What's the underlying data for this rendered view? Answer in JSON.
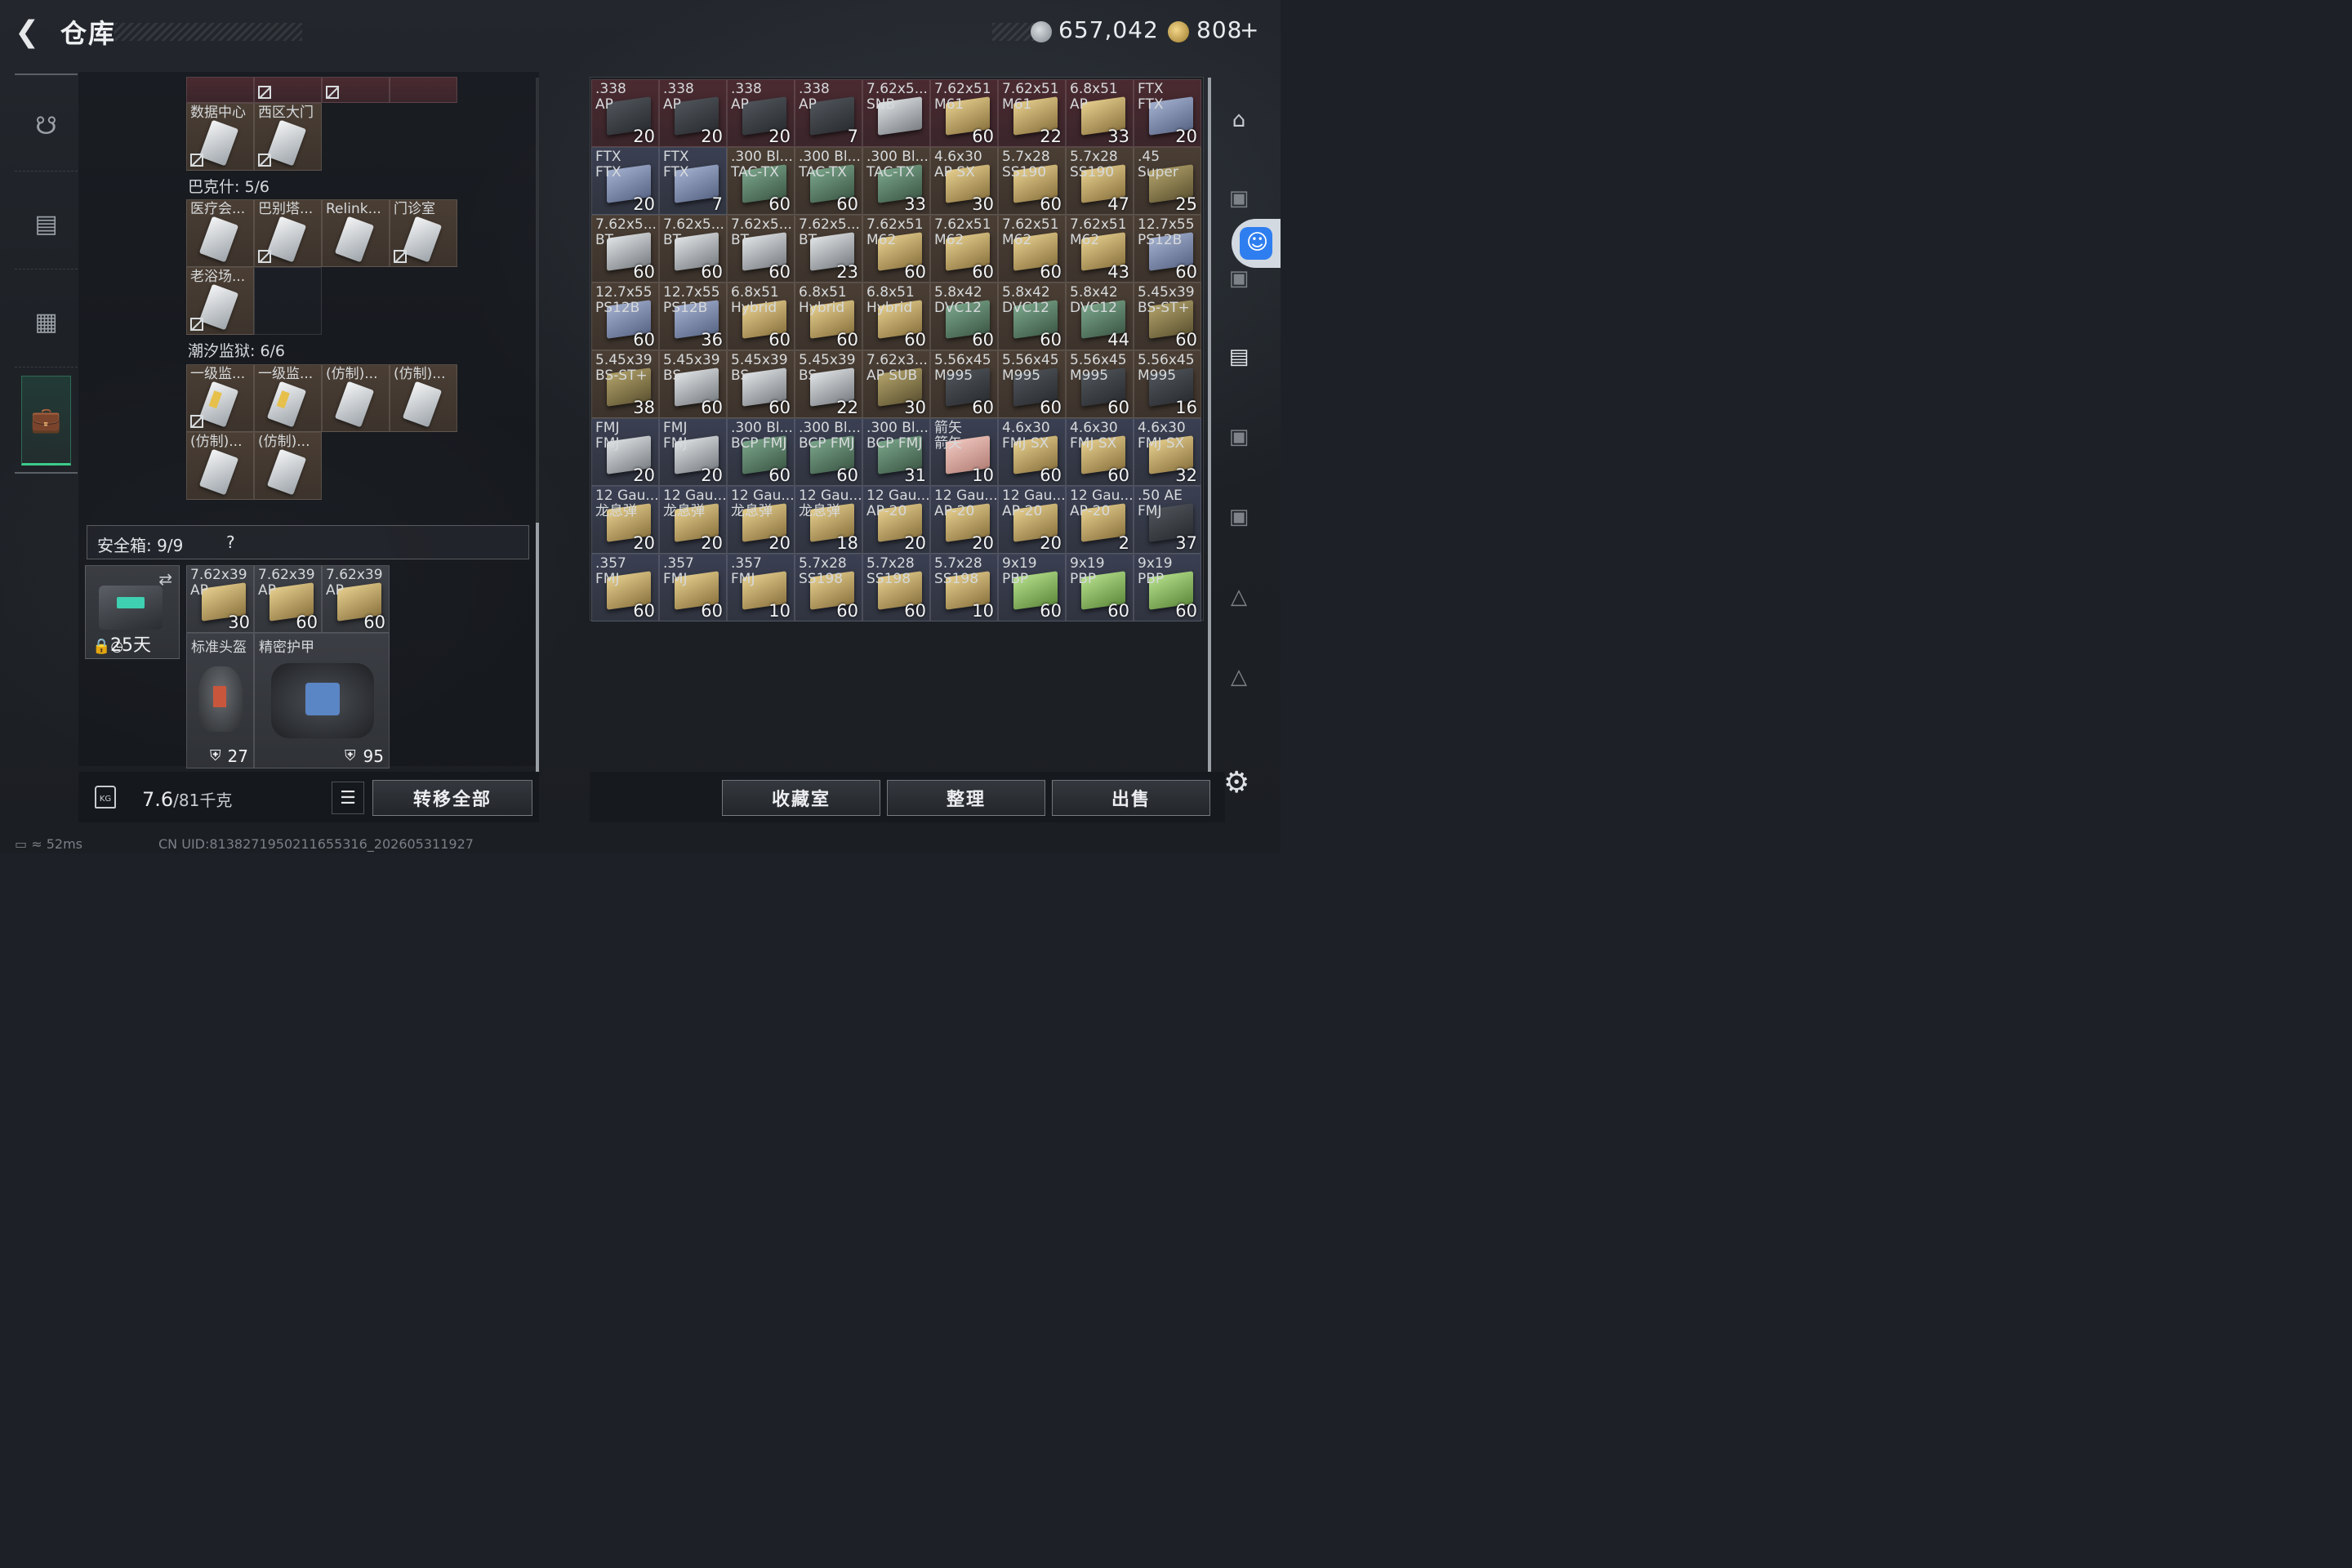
{
  "header": {
    "title": "仓库",
    "silver": "657,042",
    "gold": "808",
    "gold_plus": "+"
  },
  "left": {
    "section_bakeshi": "巴克什: 5/6",
    "section_chaoxi": "潮汐监狱: 6/6",
    "keys_top": [
      {
        "name": "数据中心",
        "locked": true
      },
      {
        "name": "西区大门",
        "locked": true
      }
    ],
    "keys_bakeshi": [
      {
        "name": "医疗会...",
        "locked": false
      },
      {
        "name": "巴别塔...",
        "locked": true
      },
      {
        "name": "Relink...",
        "locked": false
      },
      {
        "name": "门诊室",
        "locked": true
      },
      {
        "name": "老浴场...",
        "locked": true
      }
    ],
    "keys_chaoxi": [
      {
        "name": "一级监...",
        "locked": true
      },
      {
        "name": "一级监...",
        "locked": false
      },
      {
        "name": "(仿制)...",
        "locked": false
      },
      {
        "name": "(仿制)...",
        "locked": false
      },
      {
        "name": "(仿制)...",
        "locked": false
      },
      {
        "name": "(仿制)...",
        "locked": false
      }
    ],
    "safebox": {
      "label": "安全箱:",
      "count": "9/9",
      "help": "?",
      "days": "25天"
    },
    "safebox_items": [
      {
        "n1": "7.62x39",
        "n2": "AP",
        "count": "30"
      },
      {
        "n1": "7.62x39",
        "n2": "AP",
        "count": "60"
      },
      {
        "n1": "7.62x39",
        "n2": "AP",
        "count": "60"
      }
    ],
    "helmet": {
      "name": "标准头盔",
      "dur": "27"
    },
    "armor": {
      "name": "精密护甲",
      "dur": "95"
    },
    "weight": "7.6",
    "weight_max": "/81千克",
    "transfer_all": "转移全部"
  },
  "bottom": {
    "collection": "收藏室",
    "sort": "整理",
    "sell": "出售"
  },
  "status": {
    "ping": "52ms",
    "uid": "CN UID:8138271950211655316_202605311927"
  },
  "grid": [
    {
      "n1": ".338",
      "n2": "AP",
      "count": "20",
      "bg": "red",
      "box": "t-dark"
    },
    {
      "n1": ".338",
      "n2": "AP",
      "count": "20",
      "bg": "red",
      "box": "t-dark"
    },
    {
      "n1": ".338",
      "n2": "AP",
      "count": "20",
      "bg": "red",
      "box": "t-dark"
    },
    {
      "n1": ".338",
      "n2": "AP",
      "count": "7",
      "bg": "red",
      "box": "t-dark"
    },
    {
      "n1": "7.62x5...",
      "n2": "SNB",
      "count": "",
      "bg": "red",
      "box": "t-gray"
    },
    {
      "n1": "7.62x51",
      "n2": "M61",
      "count": "60",
      "bg": "red",
      "box": "t-tan"
    },
    {
      "n1": "7.62x51",
      "n2": "M61",
      "count": "22",
      "bg": "red",
      "box": "t-tan"
    },
    {
      "n1": "6.8x51",
      "n2": "AP",
      "count": "33",
      "bg": "red",
      "box": "t-tan"
    },
    {
      "n1": "FTX",
      "n2": "FTX",
      "count": "20",
      "bg": "red",
      "box": "t-blue"
    },
    {
      "n1": "FTX",
      "n2": "FTX",
      "count": "20",
      "bg": "blue",
      "box": "t-blue"
    },
    {
      "n1": "FTX",
      "n2": "FTX",
      "count": "7",
      "bg": "blue",
      "box": "t-blue"
    },
    {
      "n1": ".300 Bl...",
      "n2": "TAC-TX",
      "count": "60",
      "bg": "brown",
      "box": "t-green"
    },
    {
      "n1": ".300 Bl...",
      "n2": "TAC-TX",
      "count": "60",
      "bg": "brown",
      "box": "t-green"
    },
    {
      "n1": ".300 Bl...",
      "n2": "TAC-TX",
      "count": "33",
      "bg": "brown",
      "box": "t-green"
    },
    {
      "n1": "4.6x30",
      "n2": "AP SX",
      "count": "30",
      "bg": "brown",
      "box": "t-tan"
    },
    {
      "n1": "5.7x28",
      "n2": "SS190",
      "count": "60",
      "bg": "brown",
      "box": "t-tan"
    },
    {
      "n1": "5.7x28",
      "n2": "SS190",
      "count": "47",
      "bg": "brown",
      "box": "t-tan"
    },
    {
      "n1": ".45",
      "n2": "Super",
      "count": "25",
      "bg": "brown",
      "box": "t-olive"
    },
    {
      "n1": "7.62x5...",
      "n2": "BT",
      "count": "60",
      "bg": "brown",
      "box": "t-gray"
    },
    {
      "n1": "7.62x5...",
      "n2": "BT",
      "count": "60",
      "bg": "brown",
      "box": "t-gray"
    },
    {
      "n1": "7.62x5...",
      "n2": "BT",
      "count": "60",
      "bg": "brown",
      "box": "t-gray"
    },
    {
      "n1": "7.62x5...",
      "n2": "BT",
      "count": "23",
      "bg": "brown",
      "box": "t-gray"
    },
    {
      "n1": "7.62x51",
      "n2": "M62",
      "count": "60",
      "bg": "brown",
      "box": "t-tan"
    },
    {
      "n1": "7.62x51",
      "n2": "M62",
      "count": "60",
      "bg": "brown",
      "box": "t-tan"
    },
    {
      "n1": "7.62x51",
      "n2": "M62",
      "count": "60",
      "bg": "brown",
      "box": "t-tan"
    },
    {
      "n1": "7.62x51",
      "n2": "M62",
      "count": "43",
      "bg": "brown",
      "box": "t-tan"
    },
    {
      "n1": "12.7x55",
      "n2": "PS12B",
      "count": "60",
      "bg": "brown",
      "box": "t-blue"
    },
    {
      "n1": "12.7x55",
      "n2": "PS12B",
      "count": "60",
      "bg": "brown",
      "box": "t-blue"
    },
    {
      "n1": "12.7x55",
      "n2": "PS12B",
      "count": "36",
      "bg": "brown",
      "box": "t-blue"
    },
    {
      "n1": "6.8x51",
      "n2": "Hybrid",
      "count": "60",
      "bg": "brown",
      "box": "t-tan"
    },
    {
      "n1": "6.8x51",
      "n2": "Hybrid",
      "count": "60",
      "bg": "brown",
      "box": "t-tan"
    },
    {
      "n1": "6.8x51",
      "n2": "Hybrid",
      "count": "60",
      "bg": "brown",
      "box": "t-tan"
    },
    {
      "n1": "5.8x42",
      "n2": "DVC12",
      "count": "60",
      "bg": "brown",
      "box": "t-green"
    },
    {
      "n1": "5.8x42",
      "n2": "DVC12",
      "count": "60",
      "bg": "brown",
      "box": "t-green"
    },
    {
      "n1": "5.8x42",
      "n2": "DVC12",
      "count": "44",
      "bg": "brown",
      "box": "t-green"
    },
    {
      "n1": "5.45x39",
      "n2": "BS-ST+",
      "count": "60",
      "bg": "brown",
      "box": "t-olive"
    },
    {
      "n1": "5.45x39",
      "n2": "BS-ST+",
      "count": "38",
      "bg": "brown",
      "box": "t-olive"
    },
    {
      "n1": "5.45x39",
      "n2": "BS",
      "count": "60",
      "bg": "brown",
      "box": "t-gray"
    },
    {
      "n1": "5.45x39",
      "n2": "BS",
      "count": "60",
      "bg": "brown",
      "box": "t-gray"
    },
    {
      "n1": "5.45x39",
      "n2": "BS",
      "count": "22",
      "bg": "brown",
      "box": "t-gray"
    },
    {
      "n1": "7.62x3...",
      "n2": "AP SUB",
      "count": "30",
      "bg": "brown",
      "box": "t-olive"
    },
    {
      "n1": "5.56x45",
      "n2": "M995",
      "count": "60",
      "bg": "brown",
      "box": "t-dark"
    },
    {
      "n1": "5.56x45",
      "n2": "M995",
      "count": "60",
      "bg": "brown",
      "box": "t-dark"
    },
    {
      "n1": "5.56x45",
      "n2": "M995",
      "count": "60",
      "bg": "brown",
      "box": "t-dark"
    },
    {
      "n1": "5.56x45",
      "n2": "M995",
      "count": "16",
      "bg": "brown",
      "box": "t-dark"
    },
    {
      "n1": "FMJ",
      "n2": "FMJ",
      "count": "20",
      "bg": "blue",
      "box": "t-gray"
    },
    {
      "n1": "FMJ",
      "n2": "FMJ",
      "count": "20",
      "bg": "blue",
      "box": "t-gray"
    },
    {
      "n1": ".300 Bl...",
      "n2": "BCP FMJ",
      "count": "60",
      "bg": "blue",
      "box": "t-green"
    },
    {
      "n1": ".300 Bl...",
      "n2": "BCP FMJ",
      "count": "60",
      "bg": "blue",
      "box": "t-green"
    },
    {
      "n1": ".300 Bl...",
      "n2": "BCP FMJ",
      "count": "31",
      "bg": "blue",
      "box": "t-green"
    },
    {
      "n1": "箭矢",
      "n2": "箭矢",
      "count": "10",
      "bg": "blue",
      "box": "t-pink"
    },
    {
      "n1": "4.6x30",
      "n2": "FMJ SX",
      "count": "60",
      "bg": "blue",
      "box": "t-tan"
    },
    {
      "n1": "4.6x30",
      "n2": "FMJ SX",
      "count": "60",
      "bg": "blue",
      "box": "t-tan"
    },
    {
      "n1": "4.6x30",
      "n2": "FMJ SX",
      "count": "32",
      "bg": "blue",
      "box": "t-tan"
    },
    {
      "n1": "12 Gau...",
      "n2": "龙息弹",
      "count": "20",
      "bg": "blue",
      "box": "t-tan"
    },
    {
      "n1": "12 Gau...",
      "n2": "龙息弹",
      "count": "20",
      "bg": "blue",
      "box": "t-tan"
    },
    {
      "n1": "12 Gau...",
      "n2": "龙息弹",
      "count": "20",
      "bg": "blue",
      "box": "t-tan"
    },
    {
      "n1": "12 Gau...",
      "n2": "龙息弹",
      "count": "18",
      "bg": "blue",
      "box": "t-tan"
    },
    {
      "n1": "12 Gau...",
      "n2": "AP-20",
      "count": "20",
      "bg": "blue",
      "box": "t-tan"
    },
    {
      "n1": "12 Gau...",
      "n2": "AP-20",
      "count": "20",
      "bg": "blue",
      "box": "t-tan"
    },
    {
      "n1": "12 Gau...",
      "n2": "AP-20",
      "count": "20",
      "bg": "blue",
      "box": "t-tan"
    },
    {
      "n1": "12 Gau...",
      "n2": "AP-20",
      "count": "2",
      "bg": "blue",
      "box": "t-tan"
    },
    {
      "n1": ".50 AE",
      "n2": "FMJ",
      "count": "37",
      "bg": "blue",
      "box": "t-dark"
    },
    {
      "n1": ".357",
      "n2": "FMJ",
      "count": "60",
      "bg": "blue",
      "box": "t-tan"
    },
    {
      "n1": ".357",
      "n2": "FMJ",
      "count": "60",
      "bg": "blue",
      "box": "t-tan"
    },
    {
      "n1": ".357",
      "n2": "FMJ",
      "count": "10",
      "bg": "blue",
      "box": "t-tan"
    },
    {
      "n1": "5.7x28",
      "n2": "SS198",
      "count": "60",
      "bg": "blue",
      "box": "t-tan"
    },
    {
      "n1": "5.7x28",
      "n2": "SS198",
      "count": "60",
      "bg": "blue",
      "box": "t-tan"
    },
    {
      "n1": "5.7x28",
      "n2": "SS198",
      "count": "10",
      "bg": "blue",
      "box": "t-tan"
    },
    {
      "n1": "9x19",
      "n2": "PBP",
      "count": "60",
      "bg": "blue",
      "box": "t-lime"
    },
    {
      "n1": "9x19",
      "n2": "PBP",
      "count": "60",
      "bg": "blue",
      "box": "t-lime"
    },
    {
      "n1": "9x19",
      "n2": "PBP",
      "count": "60",
      "bg": "blue",
      "box": "t-lime"
    }
  ]
}
